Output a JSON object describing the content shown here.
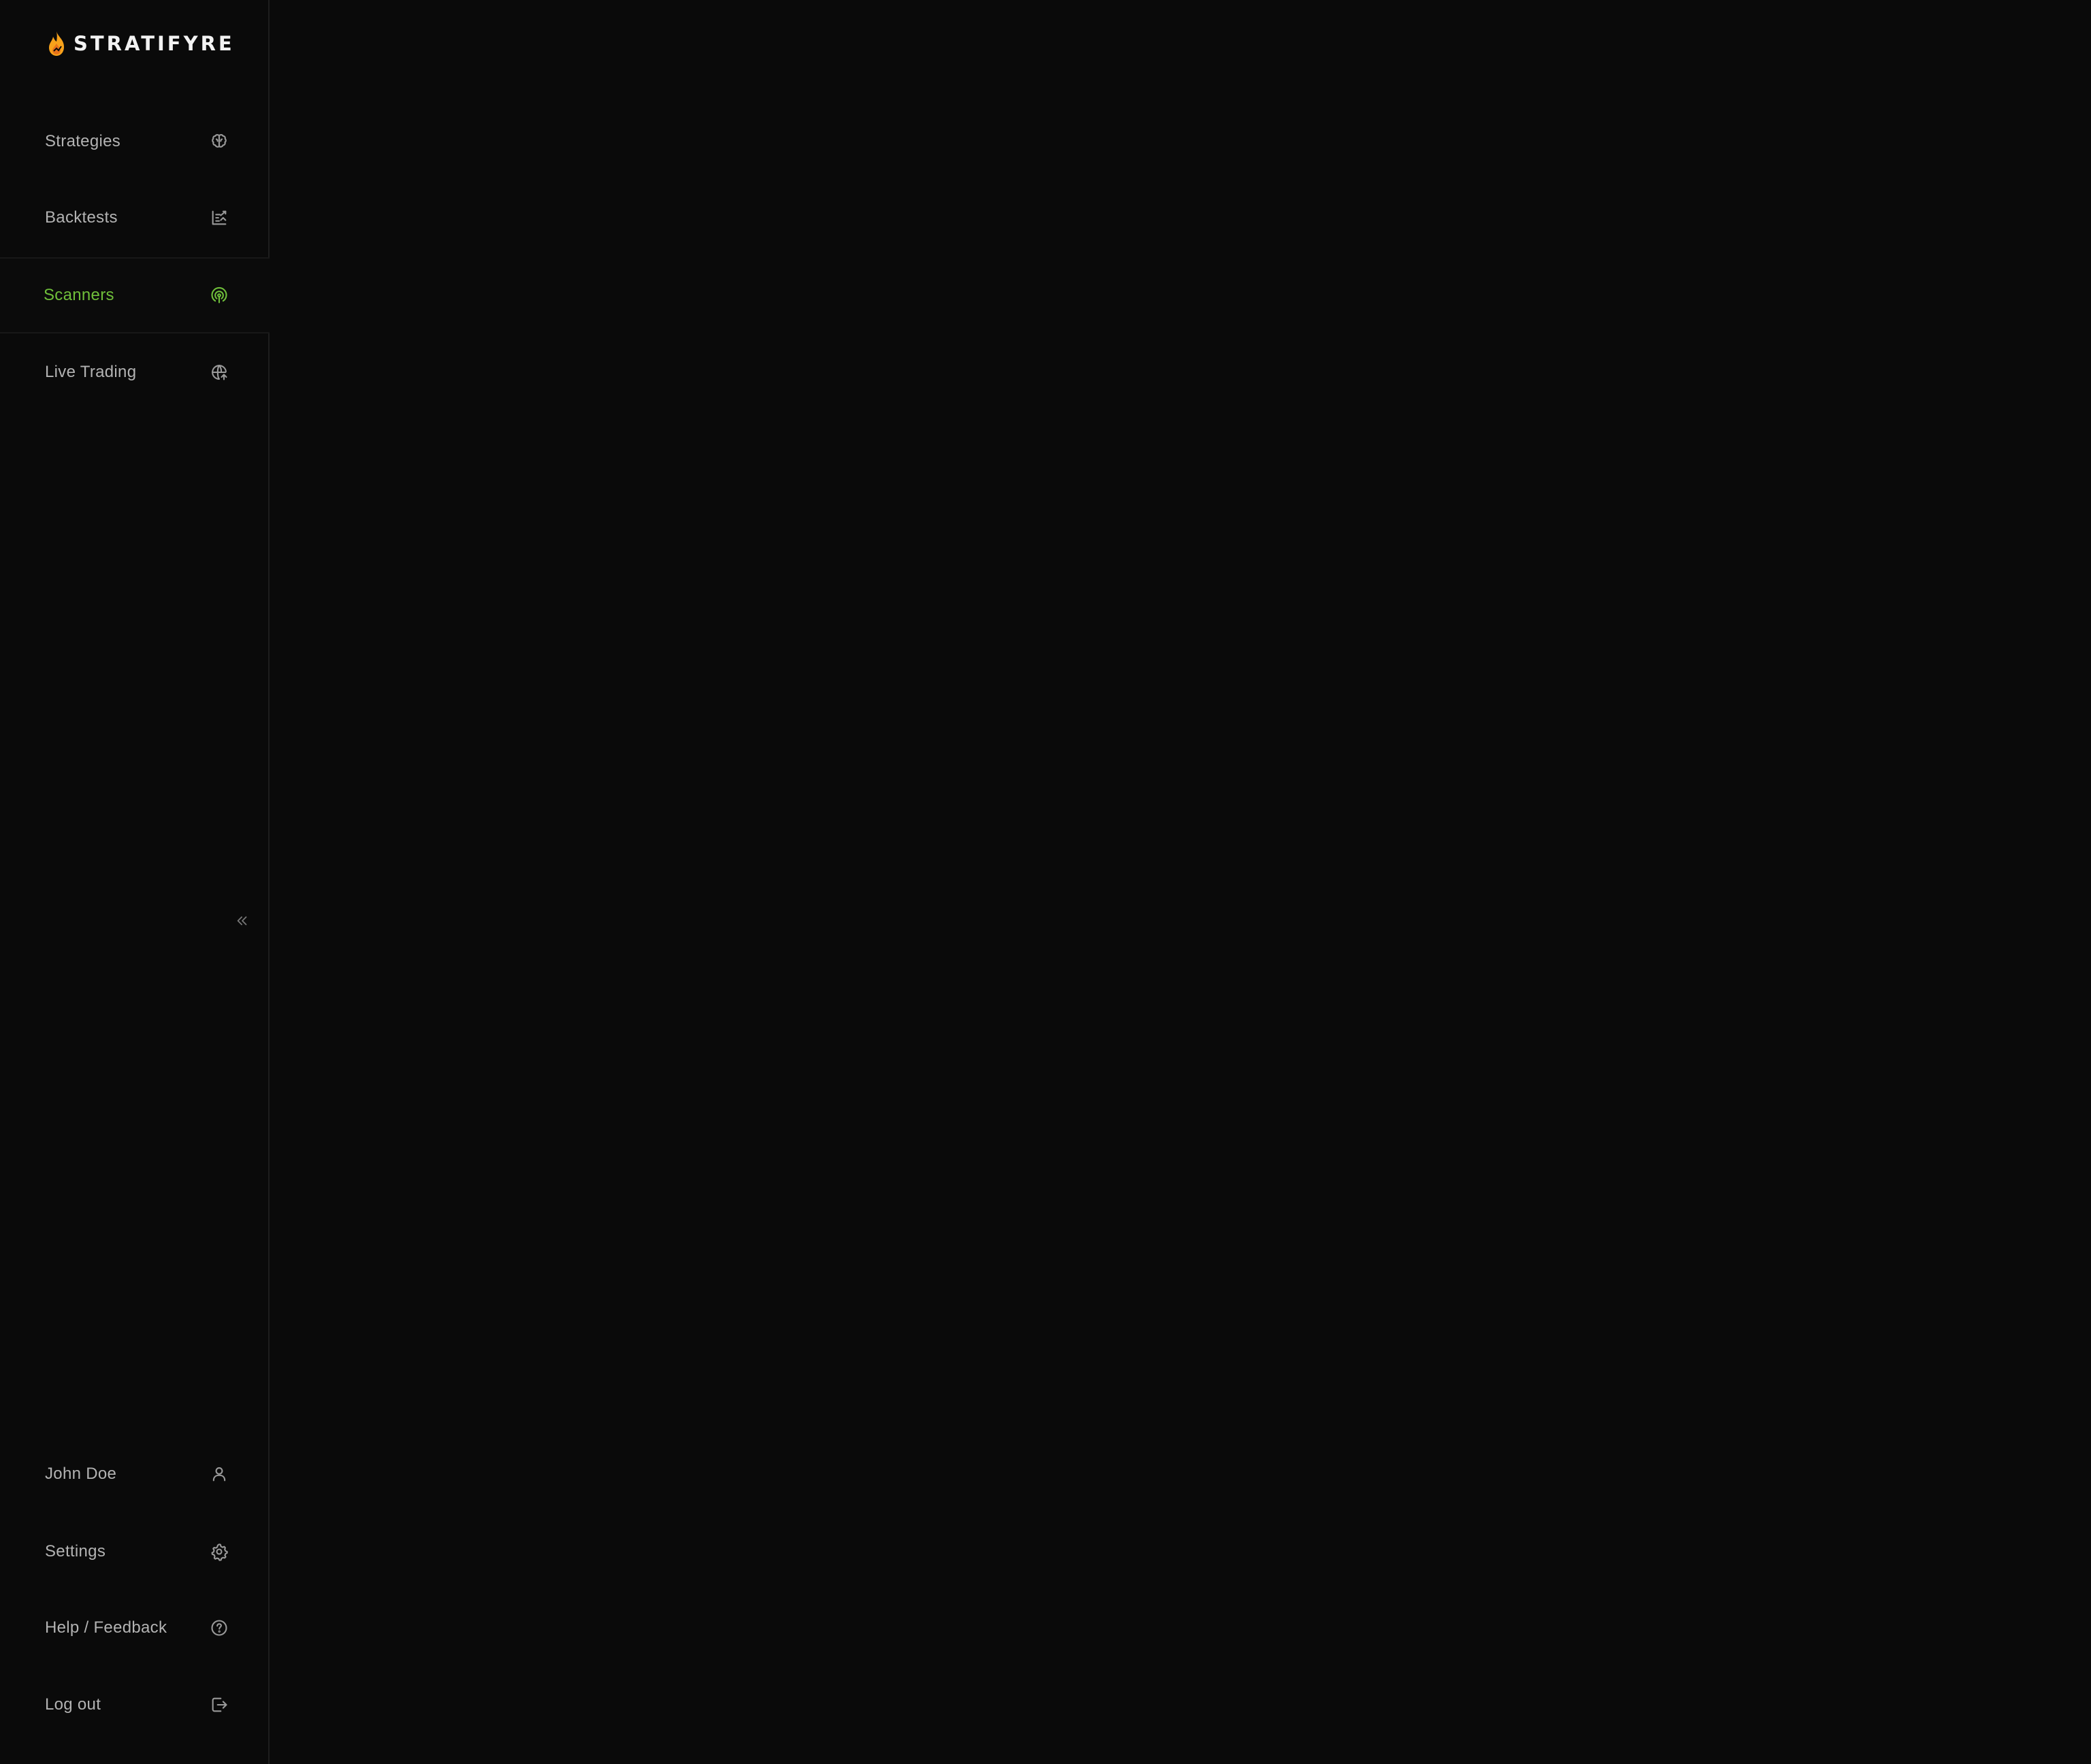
{
  "app": {
    "brand_name": "STRATIFYRE",
    "accent_color": "#6fbf3a",
    "logo_flame_colors": [
      "#f7a21b",
      "#e8731a"
    ]
  },
  "sidebar": {
    "nav_items": [
      {
        "label": "Strategies",
        "icon": "brain-icon",
        "active": false
      },
      {
        "label": "Backtests",
        "icon": "chart-history-icon",
        "active": false
      },
      {
        "label": "Scanners",
        "icon": "radar-icon",
        "active": true
      },
      {
        "label": "Live Trading",
        "icon": "globe-icon",
        "active": false
      }
    ],
    "collapse_icon": "chevrons-left-icon",
    "footer_items": [
      {
        "label": "John Doe",
        "icon": "user-icon"
      },
      {
        "label": "Settings",
        "icon": "gear-icon"
      },
      {
        "label": "Help / Feedback",
        "icon": "help-circle-icon"
      },
      {
        "label": "Log out",
        "icon": "logout-icon"
      }
    ]
  }
}
